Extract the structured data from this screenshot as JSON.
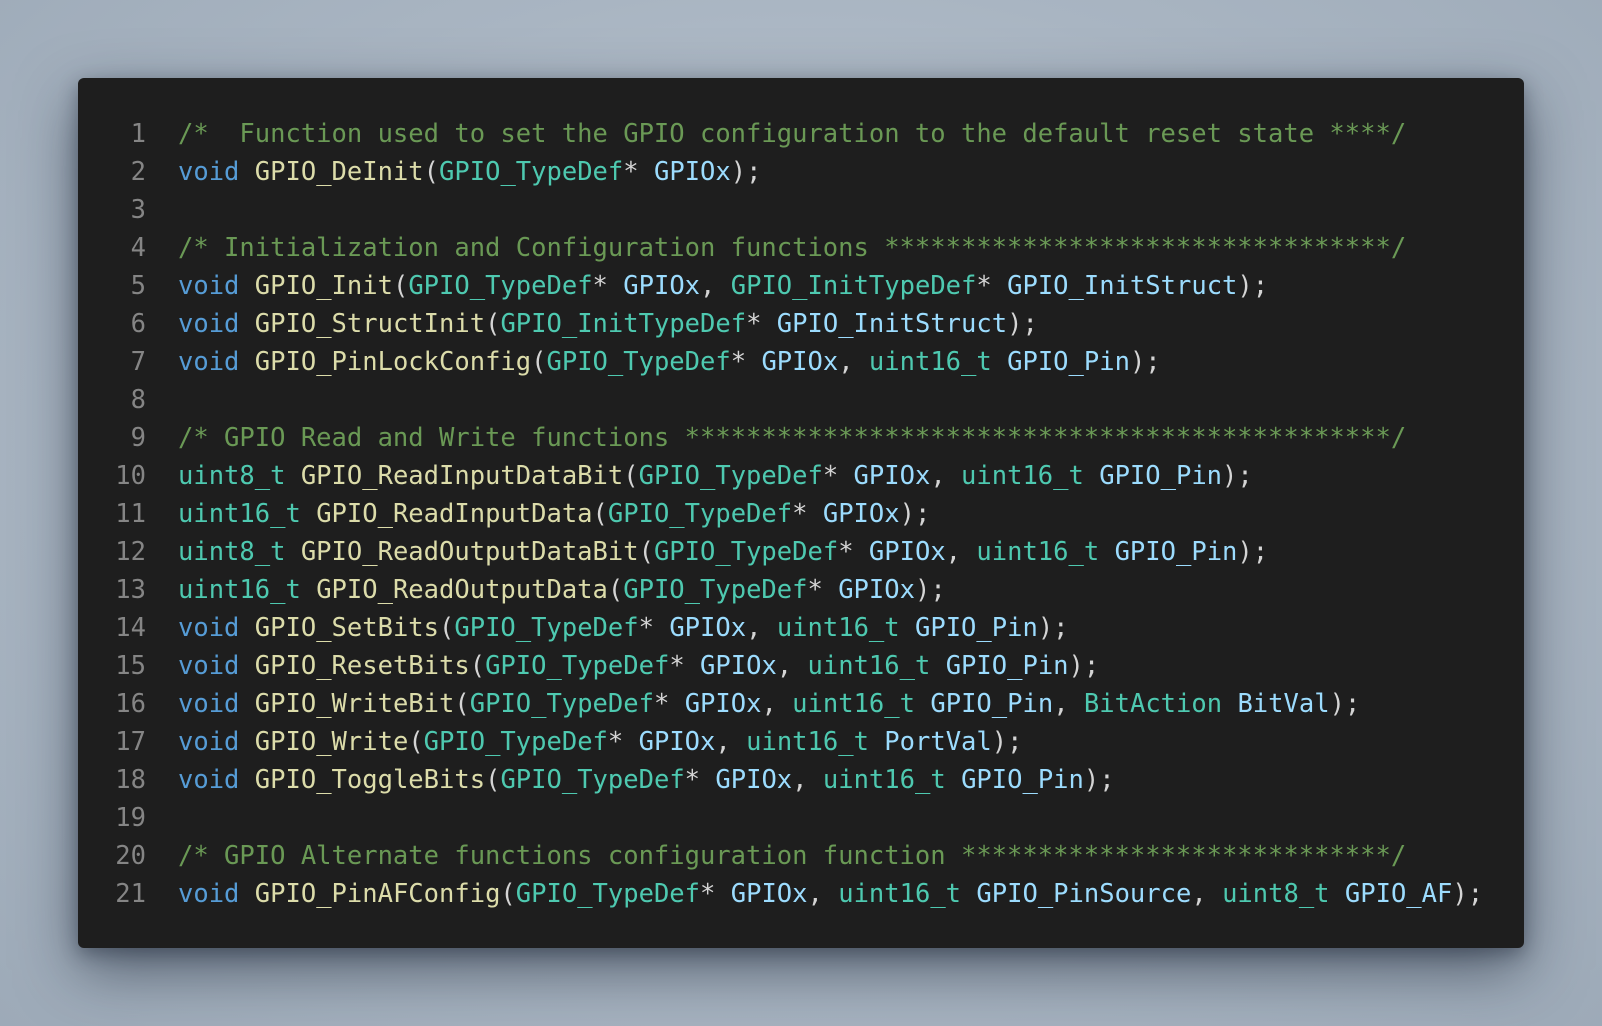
{
  "editor": {
    "language": "c",
    "theme": {
      "background": "#1e1e1e",
      "line_number": "#858585",
      "comment": "#6a9955",
      "keyword": "#569cd6",
      "type": "#4ec9b0",
      "function": "#dcdcaa",
      "parameter": "#9cdcfe",
      "punctuation": "#d4d4d4"
    },
    "lines": [
      {
        "num": "1",
        "tokens": [
          {
            "t": "/*  Function used to set the GPIO configuration to the default reset state ****/",
            "c": "comment"
          }
        ]
      },
      {
        "num": "2",
        "tokens": [
          {
            "t": "void",
            "c": "keyword"
          },
          {
            "t": " ",
            "c": "punct"
          },
          {
            "t": "GPIO_DeInit",
            "c": "func"
          },
          {
            "t": "(",
            "c": "punct"
          },
          {
            "t": "GPIO_TypeDef",
            "c": "type"
          },
          {
            "t": "* ",
            "c": "punct"
          },
          {
            "t": "GPIOx",
            "c": "param"
          },
          {
            "t": ");",
            "c": "punct"
          }
        ]
      },
      {
        "num": "3",
        "tokens": []
      },
      {
        "num": "4",
        "tokens": [
          {
            "t": "/* Initialization and Configuration functions *********************************/",
            "c": "comment"
          }
        ]
      },
      {
        "num": "5",
        "tokens": [
          {
            "t": "void",
            "c": "keyword"
          },
          {
            "t": " ",
            "c": "punct"
          },
          {
            "t": "GPIO_Init",
            "c": "func"
          },
          {
            "t": "(",
            "c": "punct"
          },
          {
            "t": "GPIO_TypeDef",
            "c": "type"
          },
          {
            "t": "* ",
            "c": "punct"
          },
          {
            "t": "GPIOx",
            "c": "param"
          },
          {
            "t": ", ",
            "c": "punct"
          },
          {
            "t": "GPIO_InitTypeDef",
            "c": "type"
          },
          {
            "t": "* ",
            "c": "punct"
          },
          {
            "t": "GPIO_InitStruct",
            "c": "param"
          },
          {
            "t": ");",
            "c": "punct"
          }
        ]
      },
      {
        "num": "6",
        "tokens": [
          {
            "t": "void",
            "c": "keyword"
          },
          {
            "t": " ",
            "c": "punct"
          },
          {
            "t": "GPIO_StructInit",
            "c": "func"
          },
          {
            "t": "(",
            "c": "punct"
          },
          {
            "t": "GPIO_InitTypeDef",
            "c": "type"
          },
          {
            "t": "* ",
            "c": "punct"
          },
          {
            "t": "GPIO_InitStruct",
            "c": "param"
          },
          {
            "t": ");",
            "c": "punct"
          }
        ]
      },
      {
        "num": "7",
        "tokens": [
          {
            "t": "void",
            "c": "keyword"
          },
          {
            "t": " ",
            "c": "punct"
          },
          {
            "t": "GPIO_PinLockConfig",
            "c": "func"
          },
          {
            "t": "(",
            "c": "punct"
          },
          {
            "t": "GPIO_TypeDef",
            "c": "type"
          },
          {
            "t": "* ",
            "c": "punct"
          },
          {
            "t": "GPIOx",
            "c": "param"
          },
          {
            "t": ", ",
            "c": "punct"
          },
          {
            "t": "uint16_t",
            "c": "type"
          },
          {
            "t": " ",
            "c": "punct"
          },
          {
            "t": "GPIO_Pin",
            "c": "param"
          },
          {
            "t": ");",
            "c": "punct"
          }
        ]
      },
      {
        "num": "8",
        "tokens": []
      },
      {
        "num": "9",
        "tokens": [
          {
            "t": "/* GPIO Read and Write functions **********************************************/",
            "c": "comment"
          }
        ]
      },
      {
        "num": "10",
        "tokens": [
          {
            "t": "uint8_t",
            "c": "type"
          },
          {
            "t": " ",
            "c": "punct"
          },
          {
            "t": "GPIO_ReadInputDataBit",
            "c": "func"
          },
          {
            "t": "(",
            "c": "punct"
          },
          {
            "t": "GPIO_TypeDef",
            "c": "type"
          },
          {
            "t": "* ",
            "c": "punct"
          },
          {
            "t": "GPIOx",
            "c": "param"
          },
          {
            "t": ", ",
            "c": "punct"
          },
          {
            "t": "uint16_t",
            "c": "type"
          },
          {
            "t": " ",
            "c": "punct"
          },
          {
            "t": "GPIO_Pin",
            "c": "param"
          },
          {
            "t": ");",
            "c": "punct"
          }
        ]
      },
      {
        "num": "11",
        "tokens": [
          {
            "t": "uint16_t",
            "c": "type"
          },
          {
            "t": " ",
            "c": "punct"
          },
          {
            "t": "GPIO_ReadInputData",
            "c": "func"
          },
          {
            "t": "(",
            "c": "punct"
          },
          {
            "t": "GPIO_TypeDef",
            "c": "type"
          },
          {
            "t": "* ",
            "c": "punct"
          },
          {
            "t": "GPIOx",
            "c": "param"
          },
          {
            "t": ");",
            "c": "punct"
          }
        ]
      },
      {
        "num": "12",
        "tokens": [
          {
            "t": "uint8_t",
            "c": "type"
          },
          {
            "t": " ",
            "c": "punct"
          },
          {
            "t": "GPIO_ReadOutputDataBit",
            "c": "func"
          },
          {
            "t": "(",
            "c": "punct"
          },
          {
            "t": "GPIO_TypeDef",
            "c": "type"
          },
          {
            "t": "* ",
            "c": "punct"
          },
          {
            "t": "GPIOx",
            "c": "param"
          },
          {
            "t": ", ",
            "c": "punct"
          },
          {
            "t": "uint16_t",
            "c": "type"
          },
          {
            "t": " ",
            "c": "punct"
          },
          {
            "t": "GPIO_Pin",
            "c": "param"
          },
          {
            "t": ");",
            "c": "punct"
          }
        ]
      },
      {
        "num": "13",
        "tokens": [
          {
            "t": "uint16_t",
            "c": "type"
          },
          {
            "t": " ",
            "c": "punct"
          },
          {
            "t": "GPIO_ReadOutputData",
            "c": "func"
          },
          {
            "t": "(",
            "c": "punct"
          },
          {
            "t": "GPIO_TypeDef",
            "c": "type"
          },
          {
            "t": "* ",
            "c": "punct"
          },
          {
            "t": "GPIOx",
            "c": "param"
          },
          {
            "t": ");",
            "c": "punct"
          }
        ]
      },
      {
        "num": "14",
        "tokens": [
          {
            "t": "void",
            "c": "keyword"
          },
          {
            "t": " ",
            "c": "punct"
          },
          {
            "t": "GPIO_SetBits",
            "c": "func"
          },
          {
            "t": "(",
            "c": "punct"
          },
          {
            "t": "GPIO_TypeDef",
            "c": "type"
          },
          {
            "t": "* ",
            "c": "punct"
          },
          {
            "t": "GPIOx",
            "c": "param"
          },
          {
            "t": ", ",
            "c": "punct"
          },
          {
            "t": "uint16_t",
            "c": "type"
          },
          {
            "t": " ",
            "c": "punct"
          },
          {
            "t": "GPIO_Pin",
            "c": "param"
          },
          {
            "t": ");",
            "c": "punct"
          }
        ]
      },
      {
        "num": "15",
        "tokens": [
          {
            "t": "void",
            "c": "keyword"
          },
          {
            "t": " ",
            "c": "punct"
          },
          {
            "t": "GPIO_ResetBits",
            "c": "func"
          },
          {
            "t": "(",
            "c": "punct"
          },
          {
            "t": "GPIO_TypeDef",
            "c": "type"
          },
          {
            "t": "* ",
            "c": "punct"
          },
          {
            "t": "GPIOx",
            "c": "param"
          },
          {
            "t": ", ",
            "c": "punct"
          },
          {
            "t": "uint16_t",
            "c": "type"
          },
          {
            "t": " ",
            "c": "punct"
          },
          {
            "t": "GPIO_Pin",
            "c": "param"
          },
          {
            "t": ");",
            "c": "punct"
          }
        ]
      },
      {
        "num": "16",
        "tokens": [
          {
            "t": "void",
            "c": "keyword"
          },
          {
            "t": " ",
            "c": "punct"
          },
          {
            "t": "GPIO_WriteBit",
            "c": "func"
          },
          {
            "t": "(",
            "c": "punct"
          },
          {
            "t": "GPIO_TypeDef",
            "c": "type"
          },
          {
            "t": "* ",
            "c": "punct"
          },
          {
            "t": "GPIOx",
            "c": "param"
          },
          {
            "t": ", ",
            "c": "punct"
          },
          {
            "t": "uint16_t",
            "c": "type"
          },
          {
            "t": " ",
            "c": "punct"
          },
          {
            "t": "GPIO_Pin",
            "c": "param"
          },
          {
            "t": ", ",
            "c": "punct"
          },
          {
            "t": "BitAction",
            "c": "type"
          },
          {
            "t": " ",
            "c": "punct"
          },
          {
            "t": "BitVal",
            "c": "param"
          },
          {
            "t": ");",
            "c": "punct"
          }
        ]
      },
      {
        "num": "17",
        "tokens": [
          {
            "t": "void",
            "c": "keyword"
          },
          {
            "t": " ",
            "c": "punct"
          },
          {
            "t": "GPIO_Write",
            "c": "func"
          },
          {
            "t": "(",
            "c": "punct"
          },
          {
            "t": "GPIO_TypeDef",
            "c": "type"
          },
          {
            "t": "* ",
            "c": "punct"
          },
          {
            "t": "GPIOx",
            "c": "param"
          },
          {
            "t": ", ",
            "c": "punct"
          },
          {
            "t": "uint16_t",
            "c": "type"
          },
          {
            "t": " ",
            "c": "punct"
          },
          {
            "t": "PortVal",
            "c": "param"
          },
          {
            "t": ");",
            "c": "punct"
          }
        ]
      },
      {
        "num": "18",
        "tokens": [
          {
            "t": "void",
            "c": "keyword"
          },
          {
            "t": " ",
            "c": "punct"
          },
          {
            "t": "GPIO_ToggleBits",
            "c": "func"
          },
          {
            "t": "(",
            "c": "punct"
          },
          {
            "t": "GPIO_TypeDef",
            "c": "type"
          },
          {
            "t": "* ",
            "c": "punct"
          },
          {
            "t": "GPIOx",
            "c": "param"
          },
          {
            "t": ", ",
            "c": "punct"
          },
          {
            "t": "uint16_t",
            "c": "type"
          },
          {
            "t": " ",
            "c": "punct"
          },
          {
            "t": "GPIO_Pin",
            "c": "param"
          },
          {
            "t": ");",
            "c": "punct"
          }
        ]
      },
      {
        "num": "19",
        "tokens": []
      },
      {
        "num": "20",
        "tokens": [
          {
            "t": "/* GPIO Alternate functions configuration function ****************************/",
            "c": "comment"
          }
        ]
      },
      {
        "num": "21",
        "tokens": [
          {
            "t": "void",
            "c": "keyword"
          },
          {
            "t": " ",
            "c": "punct"
          },
          {
            "t": "GPIO_PinAFConfig",
            "c": "func"
          },
          {
            "t": "(",
            "c": "punct"
          },
          {
            "t": "GPIO_TypeDef",
            "c": "type"
          },
          {
            "t": "* ",
            "c": "punct"
          },
          {
            "t": "GPIOx",
            "c": "param"
          },
          {
            "t": ", ",
            "c": "punct"
          },
          {
            "t": "uint16_t",
            "c": "type"
          },
          {
            "t": " ",
            "c": "punct"
          },
          {
            "t": "GPIO_PinSource",
            "c": "param"
          },
          {
            "t": ", ",
            "c": "punct"
          },
          {
            "t": "uint8_t",
            "c": "type"
          },
          {
            "t": " ",
            "c": "punct"
          },
          {
            "t": "GPIO_AF",
            "c": "param"
          },
          {
            "t": ");",
            "c": "punct"
          }
        ]
      }
    ]
  }
}
